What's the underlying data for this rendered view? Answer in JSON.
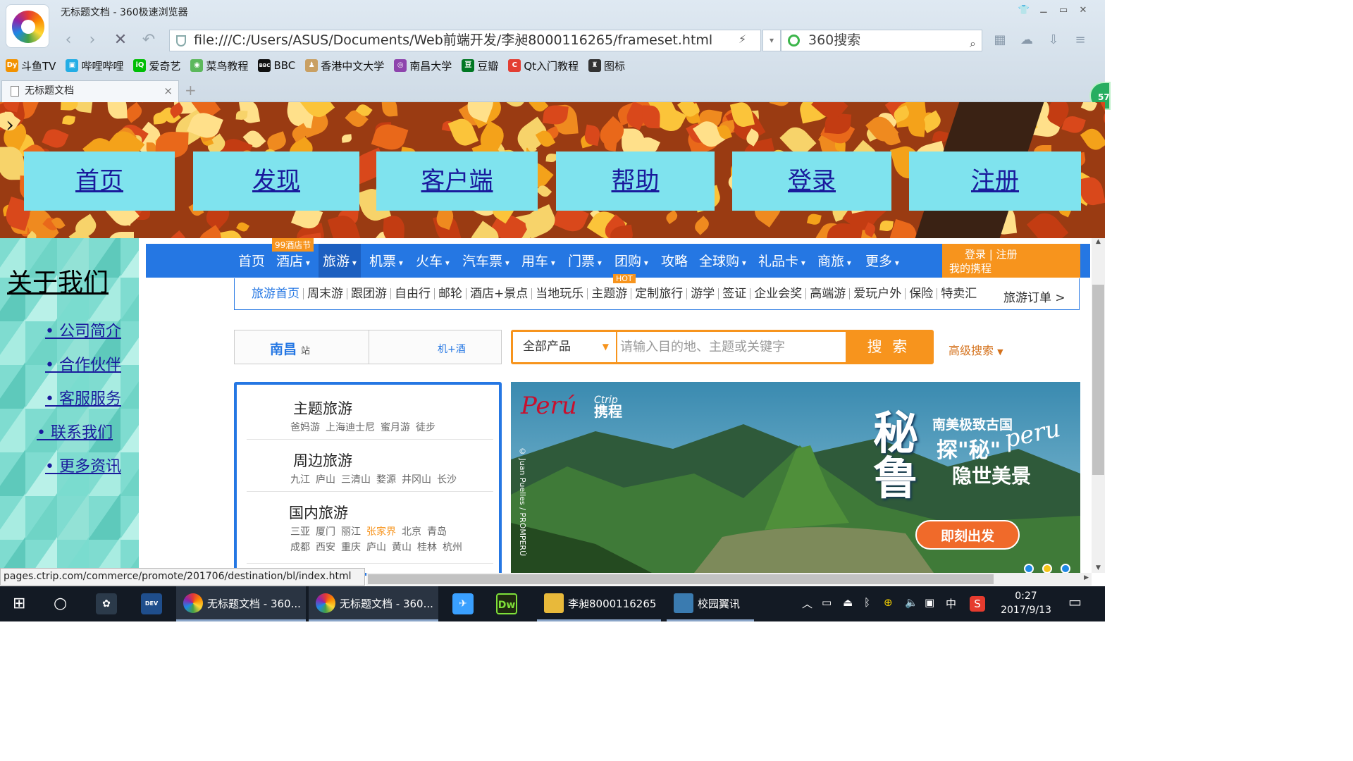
{
  "window": {
    "title": "无标题文档 - 360极速浏览器"
  },
  "address_bar": {
    "url": "file:///C:/Users/ASUS/Documents/Web前端开发/李昶8000116265/frameset.html",
    "search_engine": "360搜索"
  },
  "bookmarks": [
    {
      "label": "斗鱼TV",
      "icon": "douyu-icon",
      "color": "#f29200",
      "glyph": "Dy"
    },
    {
      "label": "哔哩哔哩",
      "icon": "bilibili-icon",
      "color": "#23ade5",
      "glyph": "▣"
    },
    {
      "label": "爱奇艺",
      "icon": "iqiyi-icon",
      "color": "#00be06",
      "glyph": "iQ"
    },
    {
      "label": "菜鸟教程",
      "icon": "runoob-icon",
      "color": "#5cb85c",
      "glyph": "◉"
    },
    {
      "label": "BBC",
      "icon": "bbc-icon",
      "color": "#111111",
      "glyph": "BBC"
    },
    {
      "label": "香港中文大学",
      "icon": "cuhk-icon",
      "color": "#c9a063",
      "glyph": "♟"
    },
    {
      "label": "南昌大学",
      "icon": "ncu-icon",
      "color": "#8e44ad",
      "glyph": "◎"
    },
    {
      "label": "豆瓣",
      "icon": "douban-icon",
      "color": "#007722",
      "glyph": "豆"
    },
    {
      "label": "Qt入门教程",
      "icon": "csdn-icon",
      "color": "#e33e33",
      "glyph": "C"
    },
    {
      "label": "图标",
      "icon": "figure-icon",
      "color": "#333333",
      "glyph": "♜"
    }
  ],
  "tab": {
    "label": "无标题文档"
  },
  "side_badge": "57",
  "top_frame": {
    "nav": [
      "首页",
      "发现",
      "客户端",
      "帮助",
      "登录",
      "注册"
    ]
  },
  "left_frame": {
    "heading": "关于我们",
    "links": [
      "• 公司简介",
      "• 合作伙伴",
      "• 客服服务",
      "• 联系我们",
      "• 更多资讯"
    ]
  },
  "ctrip": {
    "main_nav": [
      "首页",
      "酒店",
      "旅游",
      "机票",
      "火车",
      "汽车票",
      "用车",
      "门票",
      "团购",
      "攻略",
      "全球购",
      "礼品卡",
      "商旅",
      "更多"
    ],
    "hotel_badge": "99酒店节",
    "hot_badge": "HOT",
    "account": {
      "login": "登录 | 注册",
      "my": "我的携程"
    },
    "sub_nav": [
      "旅游首页",
      "周末游",
      "跟团游",
      "自由行",
      "邮轮",
      "酒店+景点",
      "当地玩乐",
      "主题游",
      "定制旅行",
      "游学",
      "签证",
      "企业会奖",
      "高端游",
      "爱玩户外",
      "保险",
      "特卖汇"
    ],
    "orders": "旅游订单 >",
    "station": {
      "city": "南昌",
      "suffix": "站",
      "combo": "机+酒"
    },
    "search": {
      "category": "全部产品",
      "placeholder": "请输入目的地、主题或关键字",
      "button": "搜 索",
      "advanced": "高级搜索"
    },
    "categories": [
      {
        "title": "主题旅游",
        "tags": [
          "爸妈游",
          "上海迪士尼",
          "蜜月游",
          "徒步"
        ]
      },
      {
        "title": "周边旅游",
        "tags": [
          "九江",
          "庐山",
          "三清山",
          "婺源",
          "井冈山",
          "长沙"
        ]
      },
      {
        "title": "国内旅游",
        "tags": [
          "三亚",
          "厦门",
          "丽江",
          "张家界",
          "北京",
          "青岛"
        ],
        "tags2": [
          "成都",
          "西安",
          "重庆",
          "庐山",
          "黄山",
          "桂林",
          "杭州"
        ],
        "highlight": "张家界"
      }
    ],
    "promo": {
      "brand1": "Perú",
      "brand2": "Ctrip",
      "brand2_cn": "携程",
      "credit": "© Juan Puelles / PROMPERÚ",
      "big": "秘鲁",
      "line1": "南美极致古国",
      "line2": "探\"秘\"",
      "line3": "隐世美景",
      "script": "peru",
      "cta": "即刻出发"
    }
  },
  "status_url": "pages.ctrip.com/commerce/promote/201706/destination/bl/index.html",
  "taskbar": {
    "tasks": [
      {
        "label": "无标题文档 - 360...",
        "icon": "browser360-icon"
      },
      {
        "label": "无标题文档 - 360...",
        "icon": "browser360-icon"
      },
      {
        "label": "李昶8000116265",
        "icon": "folder-icon"
      },
      {
        "label": "校园翼讯",
        "icon": "campus-net-icon"
      }
    ],
    "pinned": [
      {
        "icon": "pinwheel-icon"
      },
      {
        "icon": "devcpp-icon",
        "glyph": "DEV C++"
      },
      {
        "icon": "feishu-icon"
      },
      {
        "icon": "dreamweaver-icon",
        "glyph": "Dw"
      }
    ],
    "tray_lang": "中",
    "time": "0:27",
    "date": "2017/9/13"
  }
}
